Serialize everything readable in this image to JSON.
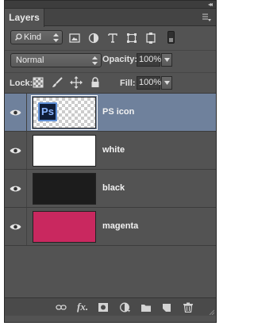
{
  "panel": {
    "tab_label": "Layers",
    "collapse_glyph": "◂◂"
  },
  "filter_bar": {
    "kind_label": "Kind",
    "icons": [
      "pixel-layer-filter-icon",
      "adjustment-layer-filter-icon",
      "type-layer-filter-icon",
      "shape-layer-filter-icon",
      "smart-object-filter-icon"
    ]
  },
  "blend": {
    "mode": "Normal",
    "opacity_label": "Opacity:",
    "opacity_value": "100%"
  },
  "lock": {
    "label": "Lock:",
    "fill_label": "Fill:",
    "fill_value": "100%"
  },
  "layers": [
    {
      "name": "PS icon",
      "thumb": "transparent-with-ps-logo",
      "logo_text": "Ps",
      "selected": true,
      "visible": true
    },
    {
      "name": "white",
      "thumb_color": "#ffffff",
      "selected": false,
      "visible": true
    },
    {
      "name": "black",
      "thumb_color": "#1c1c1c",
      "selected": false,
      "visible": true
    },
    {
      "name": "magenta",
      "thumb_color": "#c9285f",
      "selected": false,
      "visible": true
    }
  ],
  "bottom_bar": {
    "fx_label": "fx.",
    "icons": [
      "link-layers-icon",
      "add-layer-style-icon",
      "add-mask-icon",
      "adjustment-layer-icon",
      "new-group-icon",
      "new-layer-icon",
      "trash-icon"
    ]
  },
  "colors": {
    "panel_bg": "#535353",
    "selection": "#6f819c",
    "text": "#e8e8e8"
  }
}
